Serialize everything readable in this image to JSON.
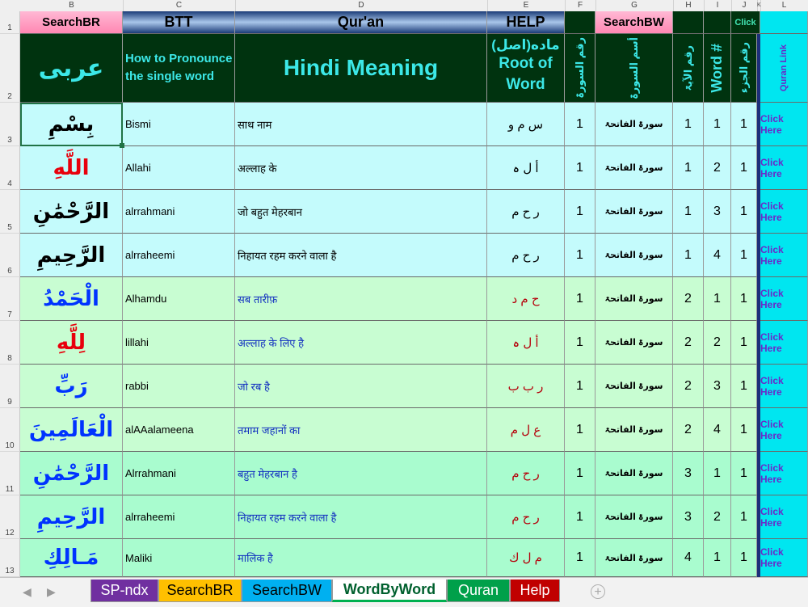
{
  "column_headers": [
    "B",
    "C",
    "D",
    "E",
    "F",
    "G",
    "H",
    "I",
    "J",
    "K",
    "L"
  ],
  "row_numbers": [
    "1",
    "2",
    "3",
    "4",
    "5",
    "6",
    "7",
    "8",
    "9",
    "10",
    "11",
    "12",
    "13"
  ],
  "row1_buttons": {
    "search_br": "SearchBR",
    "btt": "BTT",
    "quran": "Qur'an",
    "help": "HELP",
    "search_bw": "SearchBW",
    "click": "Click"
  },
  "row2_headers": {
    "arabic": "عربی",
    "pronounce": "How to Pronounce the single word",
    "hindi_meaning": "Hindi Meaning",
    "root_line1": "ماده(اصل)",
    "root_line2": "Root of Word",
    "surah_num": "رقم السورۃ",
    "surah_name": "أسم السورۃ",
    "ayah_num": "رقم الآیۃ",
    "word_num": "Word #",
    "juz_num": "رقم الجزء",
    "quran_link": "Quran Link"
  },
  "rows": [
    {
      "arabic": "بِسْمِ",
      "translit": "Bismi",
      "hindi": "साथ नाम",
      "root": "س م و",
      "surah": "1",
      "surah_name": "سورۃ الفاتحۃ",
      "ayah": "1",
      "word": "1",
      "juz": "1",
      "link": "Click Here"
    },
    {
      "arabic": "اللَّهِ",
      "translit": "Allahi",
      "hindi": "अल्लाह के",
      "root": "أ ل ہ",
      "surah": "1",
      "surah_name": "سورۃ الفاتحۃ",
      "ayah": "1",
      "word": "2",
      "juz": "1",
      "link": "Click Here"
    },
    {
      "arabic": "الرَّحْمَٰنِ",
      "translit": "alrrahmani",
      "hindi": "जो बहुत मेहरबान",
      "root": "ر ح م",
      "surah": "1",
      "surah_name": "سورۃ الفاتحۃ",
      "ayah": "1",
      "word": "3",
      "juz": "1",
      "link": "Click Here"
    },
    {
      "arabic": "الرَّحِيمِ",
      "translit": "alrraheemi",
      "hindi": "निहायत रहम करने वाला है",
      "root": "ر ح م",
      "surah": "1",
      "surah_name": "سورۃ الفاتحۃ",
      "ayah": "1",
      "word": "4",
      "juz": "1",
      "link": "Click Here"
    },
    {
      "arabic": "الْحَمْدُ",
      "translit": "Alhamdu",
      "hindi": "सब तारीफ़",
      "root": "ح م د",
      "surah": "1",
      "surah_name": "سورۃ الفاتحۃ",
      "ayah": "2",
      "word": "1",
      "juz": "1",
      "link": "Click Here"
    },
    {
      "arabic": "لِلَّهِ",
      "translit": "lillahi",
      "hindi": "अल्लाह के लिए है",
      "root": "أ ل ہ",
      "surah": "1",
      "surah_name": "سورۃ الفاتحۃ",
      "ayah": "2",
      "word": "2",
      "juz": "1",
      "link": "Click Here"
    },
    {
      "arabic": "رَبِّ",
      "translit": "rabbi",
      "hindi": "जो रब है",
      "root": "ر ب ب",
      "surah": "1",
      "surah_name": "سورۃ الفاتحۃ",
      "ayah": "2",
      "word": "3",
      "juz": "1",
      "link": "Click Here"
    },
    {
      "arabic": "الْعَالَمِينَ",
      "translit": "alAAalameena",
      "hindi": "तमाम जहानों का",
      "root": "ع ل م",
      "surah": "1",
      "surah_name": "سورۃ الفاتحۃ",
      "ayah": "2",
      "word": "4",
      "juz": "1",
      "link": "Click Here"
    },
    {
      "arabic": "الرَّحْمَٰنِ",
      "translit": "Alrrahmani",
      "hindi": "बहुत मेहरबान है",
      "root": "ر ح م",
      "surah": "1",
      "surah_name": "سورۃ الفاتحۃ",
      "ayah": "3",
      "word": "1",
      "juz": "1",
      "link": "Click Here"
    },
    {
      "arabic": "الرَّحِيمِ",
      "translit": "alrraheemi",
      "hindi": "निहायत रहम करने वाला है",
      "root": "ر ح م",
      "surah": "1",
      "surah_name": "سورۃ الفاتحۃ",
      "ayah": "3",
      "word": "2",
      "juz": "1",
      "link": "Click Here"
    },
    {
      "arabic": "مَـالِكِ",
      "translit": "Maliki",
      "hindi": "मालिक है",
      "root": "م ل ك",
      "surah": "1",
      "surah_name": "سورۃ الفاتحۃ",
      "ayah": "4",
      "word": "1",
      "juz": "1",
      "link": "Click Here"
    }
  ],
  "sheet_tabs": [
    "SP-ndx",
    "SearchBR",
    "SearchBW",
    "WordByWord",
    "Quran",
    "Help"
  ],
  "active_sheet": "WordByWord",
  "colors": {
    "header_dark": "#00330f",
    "header_text": "#3ce8e8",
    "row_cyan": "#c4fbfc",
    "row_green": "#c8fdd2",
    "row_mint": "#a9fccf",
    "arabic_black": "#000000",
    "arabic_red": "#e8000c",
    "arabic_blue": "#0033ff",
    "hindi_blue": "#1230c0",
    "link_bg": "#00e6f0",
    "link_text": "#6a2ac8"
  }
}
